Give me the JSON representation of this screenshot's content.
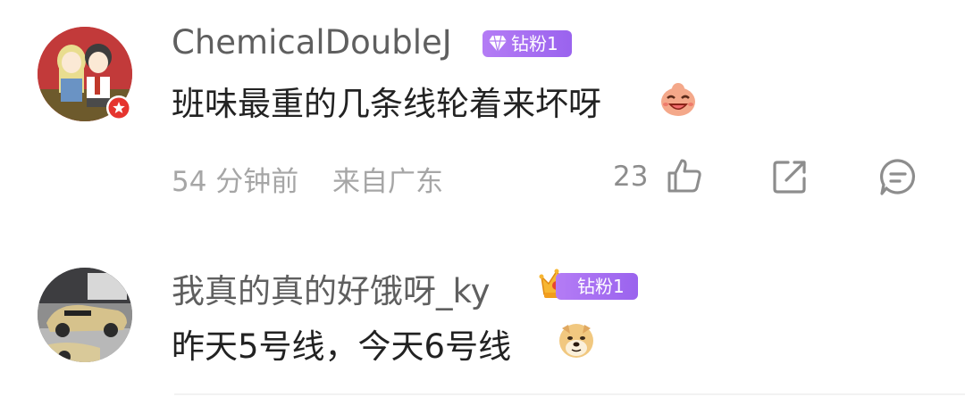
{
  "comments": [
    {
      "username": "ChemicalDoubleJ",
      "badge": "钻粉1",
      "text": "班味最重的几条线轮着来坏呀",
      "time": "54 分钟前",
      "location": "来自广东",
      "likes": "23"
    },
    {
      "username": "我真的真的好饿呀_ky",
      "badge": "钻粉1",
      "text": "昨天5号线，今天6号线"
    }
  ],
  "icons": {
    "like": "thumbs-up-icon",
    "share": "share-icon",
    "reply": "comment-icon",
    "emoji1": "laughing-emoji-icon",
    "emoji2": "doge-emoji-icon",
    "verified": "verified-badge-icon"
  },
  "colors": {
    "badge": "#a66ff2",
    "meta": "#a6a6a6",
    "username": "#5f5f5f"
  }
}
